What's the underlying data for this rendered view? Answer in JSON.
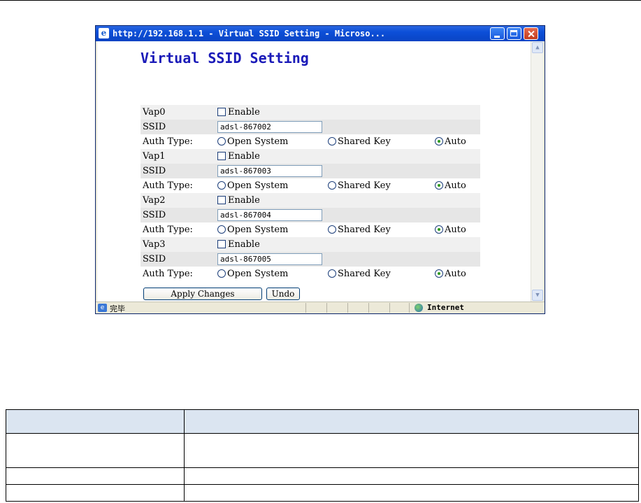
{
  "window": {
    "title": "http://192.168.1.1 - Virtual SSID Setting - Microso...",
    "ie_logo": "e",
    "buttons": [
      "minimize-icon",
      "maximize-icon",
      "close-icon"
    ]
  },
  "page": {
    "title": "Virtual SSID Setting"
  },
  "labels": {
    "ssid": "SSID",
    "auth_type": "Auth Type:",
    "enable": "Enable",
    "open_system": "Open System",
    "shared_key": "Shared Key",
    "auto": "Auto"
  },
  "vaps": [
    {
      "name": "Vap0",
      "enabled": false,
      "ssid": "adsl-867002",
      "auth": "Auto"
    },
    {
      "name": "Vap1",
      "enabled": false,
      "ssid": "adsl-867003",
      "auth": "Auto"
    },
    {
      "name": "Vap2",
      "enabled": false,
      "ssid": "adsl-867004",
      "auth": "Auto"
    },
    {
      "name": "Vap3",
      "enabled": false,
      "ssid": "adsl-867005",
      "auth": "Auto"
    }
  ],
  "buttons": {
    "apply": "Apply Changes",
    "undo": "Undo"
  },
  "statusbar": {
    "text": "完毕",
    "zone": "Internet"
  },
  "colors": {
    "title_blue": "#1a1ab8",
    "header_fill": "#dbe5f1"
  }
}
